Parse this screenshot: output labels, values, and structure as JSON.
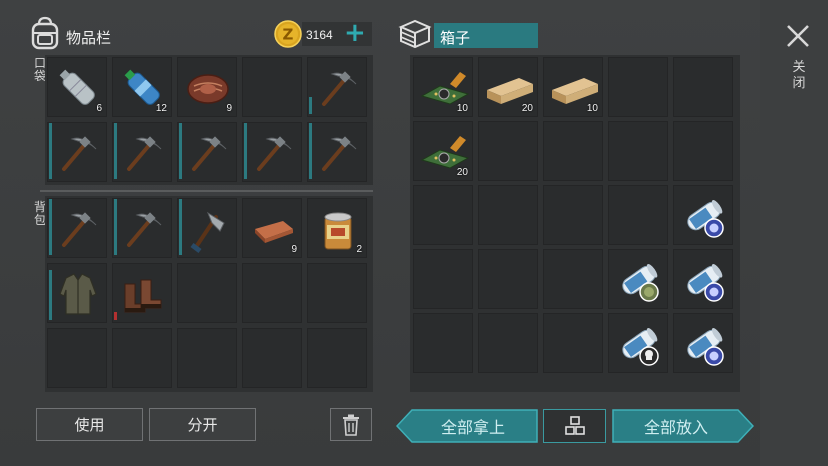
{
  "colors": {
    "accent_teal": "#2e8e94",
    "durability_teal": "#2c7a80",
    "durability_red": "#b33030",
    "gold": "#d9a520"
  },
  "inventory": {
    "title": "物品栏",
    "currency": {
      "icon": "z-coin-icon",
      "amount": "3164",
      "add_label": "+"
    },
    "pocket_label": "口袋",
    "backpack_label": "背包",
    "pocket_slots": [
      {
        "item": "plastic-bottle",
        "qty": "6",
        "durability": null
      },
      {
        "item": "water-bottle",
        "qty": "12",
        "durability": null
      },
      {
        "item": "cooked-meat",
        "qty": "9",
        "durability": null
      },
      {
        "item": "empty",
        "qty": "",
        "durability": null
      },
      {
        "item": "pickaxe",
        "qty": "",
        "durability": 0.3
      },
      {
        "item": "pickaxe",
        "qty": "",
        "durability": 1.0
      },
      {
        "item": "pickaxe",
        "qty": "",
        "durability": 1.0
      },
      {
        "item": "pickaxe",
        "qty": "",
        "durability": 1.0
      },
      {
        "item": "pickaxe",
        "qty": "",
        "durability": 1.0
      },
      {
        "item": "pickaxe",
        "qty": "",
        "durability": 1.0
      }
    ],
    "backpack_slots": [
      {
        "item": "pickaxe",
        "qty": "",
        "durability": 1.0
      },
      {
        "item": "pickaxe",
        "qty": "",
        "durability": 1.0
      },
      {
        "item": "hatchet",
        "qty": "",
        "durability": 1.0
      },
      {
        "item": "copper-ingot",
        "qty": "9",
        "durability": null
      },
      {
        "item": "canned-food",
        "qty": "2",
        "durability": null
      },
      {
        "item": "leather-jacket",
        "qty": "",
        "durability": 0.9
      },
      {
        "item": "leather-boots",
        "qty": "",
        "durability": 0.15,
        "durability_color": "red"
      },
      {
        "item": "empty",
        "qty": "",
        "durability": null
      },
      {
        "item": "empty",
        "qty": "",
        "durability": null
      },
      {
        "item": "empty",
        "qty": "",
        "durability": null
      },
      {
        "item": "empty",
        "qty": "",
        "durability": null
      },
      {
        "item": "empty",
        "qty": "",
        "durability": null
      },
      {
        "item": "empty",
        "qty": "",
        "durability": null
      },
      {
        "item": "empty",
        "qty": "",
        "durability": null
      },
      {
        "item": "empty",
        "qty": "",
        "durability": null
      }
    ],
    "use_button": "使用",
    "split_button": "分开",
    "trash_icon": "trash-icon"
  },
  "box": {
    "icon": "crate-icon",
    "title": "箱子",
    "slots": [
      {
        "item": "circuit-board",
        "qty": "10"
      },
      {
        "item": "wood-plank",
        "qty": "20"
      },
      {
        "item": "wood-plank",
        "qty": "10"
      },
      {
        "item": "empty",
        "qty": ""
      },
      {
        "item": "empty",
        "qty": ""
      },
      {
        "item": "circuit-board",
        "qty": "20"
      },
      {
        "item": "empty",
        "qty": ""
      },
      {
        "item": "empty",
        "qty": ""
      },
      {
        "item": "empty",
        "qty": ""
      },
      {
        "item": "empty",
        "qty": ""
      },
      {
        "item": "empty",
        "qty": ""
      },
      {
        "item": "empty",
        "qty": ""
      },
      {
        "item": "empty",
        "qty": ""
      },
      {
        "item": "empty",
        "qty": ""
      },
      {
        "item": "blueprint-blue",
        "qty": ""
      },
      {
        "item": "empty",
        "qty": ""
      },
      {
        "item": "empty",
        "qty": ""
      },
      {
        "item": "empty",
        "qty": ""
      },
      {
        "item": "blueprint-green",
        "qty": ""
      },
      {
        "item": "blueprint-blue",
        "qty": ""
      },
      {
        "item": "empty",
        "qty": ""
      },
      {
        "item": "empty",
        "qty": ""
      },
      {
        "item": "empty",
        "qty": ""
      },
      {
        "item": "blueprint-skull",
        "qty": ""
      },
      {
        "item": "blueprint-blue",
        "qty": ""
      }
    ],
    "take_all_button": "全部拿上",
    "sort_icon": "grid-sort-icon",
    "put_all_button": "全部放入"
  },
  "close": {
    "icon": "close-icon",
    "label": "关闭"
  }
}
